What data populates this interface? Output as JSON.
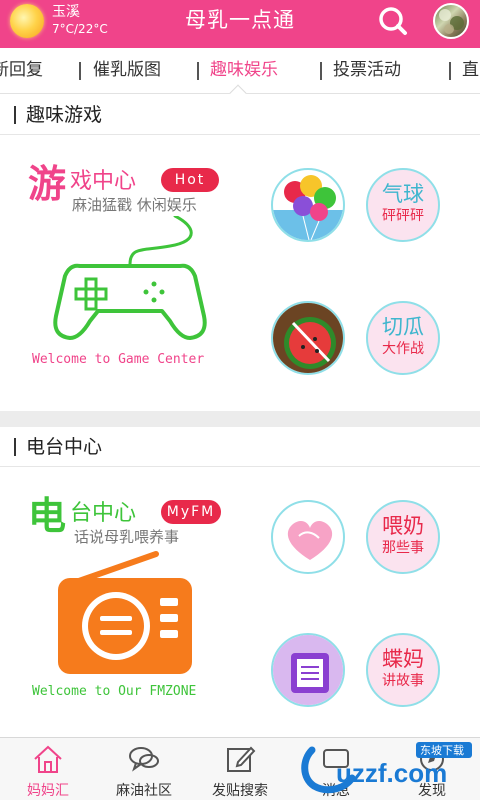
{
  "header": {
    "city": "玉溪",
    "temperature": "7°C/22°C",
    "title": "母乳一点通"
  },
  "tabs": [
    {
      "label": "新回复"
    },
    {
      "label": "催乳版图"
    },
    {
      "label": "趣味娱乐"
    },
    {
      "label": "投票活动"
    },
    {
      "label": "直"
    }
  ],
  "games_section": {
    "title": "趣味游戏",
    "banner": {
      "big_char": "游",
      "heading": "戏中心",
      "badge": "Hot",
      "subtitle": "麻油猛戳 休闲娱乐",
      "welcome": "Welcome to Game Center"
    },
    "items": [
      {
        "line1": "气球",
        "line2": "砰砰砰"
      },
      {
        "line1": "切瓜",
        "line2": "大作战"
      }
    ]
  },
  "radio_section": {
    "title": "电台中心",
    "banner": {
      "big_char": "电",
      "heading": "台中心",
      "badge": "MyFM",
      "subtitle": "话说母乳喂养事",
      "welcome": "Welcome to Our FMZONE"
    },
    "items": [
      {
        "line1": "喂奶",
        "line2": "那些事"
      },
      {
        "line1": "蝶妈",
        "line2": "讲故事"
      }
    ]
  },
  "bottom_nav": [
    {
      "label": "妈妈汇",
      "icon": "home-icon"
    },
    {
      "label": "麻油社区",
      "icon": "chat-bubbles-icon"
    },
    {
      "label": "发贴搜索",
      "icon": "compose-icon"
    },
    {
      "label": "消息",
      "icon": "message-icon"
    },
    {
      "label": "发现",
      "icon": "discover-icon"
    }
  ],
  "watermark": {
    "logo_text": "uzzf.com",
    "badge": "东坡下载"
  },
  "colors": {
    "brand_pink": "#f0448a",
    "game_green": "#3ec43a",
    "radio_orange": "#f67b1c",
    "badge_red": "#e8294a",
    "circle_border": "#8fdfe8"
  }
}
